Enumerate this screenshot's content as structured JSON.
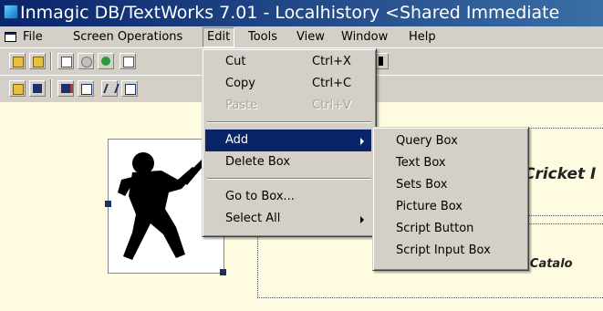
{
  "window": {
    "title": "Inmagic DB/TextWorks 7.01 - Localhistory <Shared Immediate"
  },
  "menubar": {
    "items": [
      "File",
      "Screen Operations",
      "Edit",
      "Tools",
      "View",
      "Window",
      "Help"
    ],
    "active": "Edit"
  },
  "edit_menu": {
    "items": [
      {
        "label": "Cut",
        "shortcut": "Ctrl+X",
        "enabled": true
      },
      {
        "label": "Copy",
        "shortcut": "Ctrl+C",
        "enabled": true
      },
      {
        "label": "Paste",
        "shortcut": "Ctrl+V",
        "enabled": false
      },
      {
        "label": "Add",
        "submenu": true,
        "highlighted": true
      },
      {
        "label": "Delete Box"
      },
      {
        "label": "Go to Box..."
      },
      {
        "label": "Select All",
        "submenu": true
      }
    ]
  },
  "add_submenu": {
    "items": [
      "Query Box",
      "Text Box",
      "Sets Box",
      "Picture Box",
      "Script Button",
      "Script Input Box"
    ]
  },
  "canvas": {
    "heading_text": "Cricket I",
    "catalog_text": "brary Catalo"
  },
  "colors": {
    "menu_highlight": "#0a246a",
    "canvas_background": "#fffbe0",
    "title_gradient_start": "#0a246a",
    "title_gradient_end": "#3a6ea5"
  }
}
